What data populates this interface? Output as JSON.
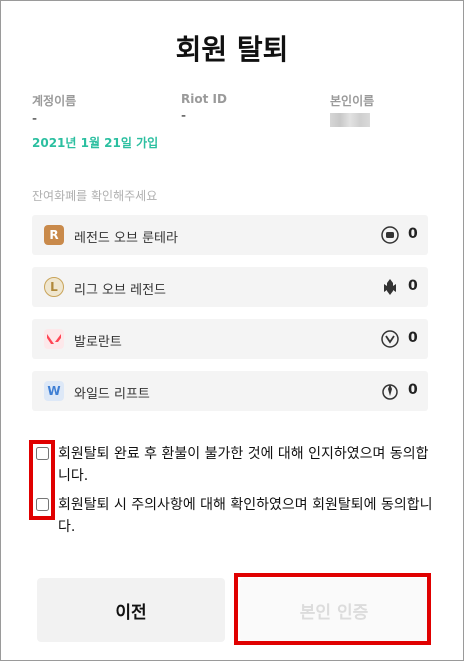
{
  "title": "회원 탈퇴",
  "info": {
    "account_label": "계정이름",
    "account_value": "-",
    "riot_label": "Riot ID",
    "riot_value": "-",
    "name_label": "본인이름",
    "joined": "2021년 1월 21일 가입"
  },
  "balance_label": "잔여화폐를 확인해주세요",
  "games": [
    {
      "name": "레전드 오브 룬테라",
      "icon": "runeterra-icon",
      "currency_icon": "runeterra-coin-icon",
      "value": "0"
    },
    {
      "name": "리그 오브 레전드",
      "icon": "league-icon",
      "currency_icon": "riot-points-icon",
      "value": "0"
    },
    {
      "name": "발로란트",
      "icon": "valorant-icon",
      "currency_icon": "valorant-points-icon",
      "value": "0"
    },
    {
      "name": "와일드 리프트",
      "icon": "wildrift-icon",
      "currency_icon": "wild-cores-icon",
      "value": "0"
    }
  ],
  "consents": [
    {
      "text": "회원탈퇴 완료 후 환불이 불가한 것에 대해 인지하였으며 동의합니다."
    },
    {
      "text": "회원탈퇴 시 주의사항에 대해 확인하였으며 회원탈퇴에 동의합니다."
    }
  ],
  "buttons": {
    "prev": "이전",
    "verify": "본인 인증"
  },
  "colors": {
    "accent": "#2bbfa0",
    "highlight": "#e00000"
  }
}
